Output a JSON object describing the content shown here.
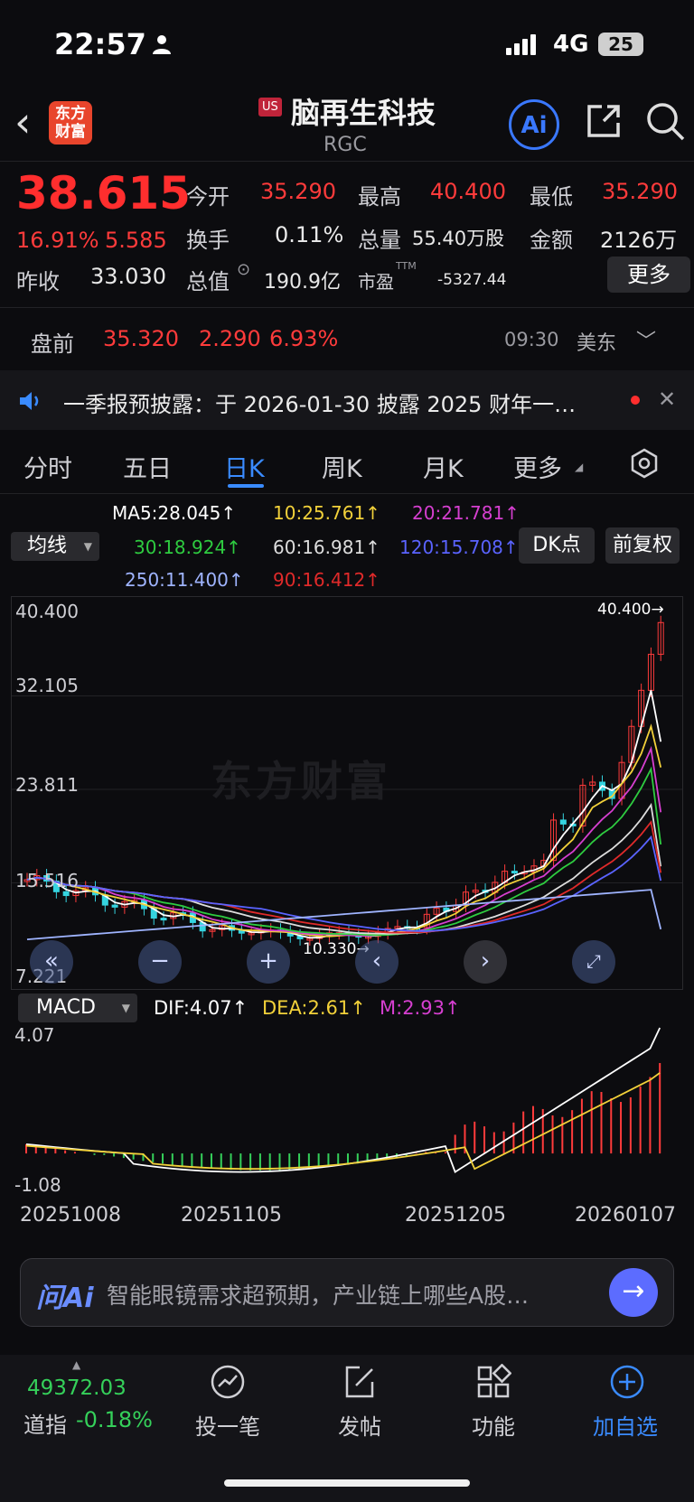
{
  "status_bar": {
    "time": "22:57",
    "network": "4G",
    "battery": "25"
  },
  "header": {
    "logo_line1": "东方",
    "logo_line2": "财富",
    "market_badge": "US",
    "stock_name": "脑再生科技",
    "ticker": "RGC",
    "ai_label": "Ai"
  },
  "quote": {
    "price": "38.615",
    "change_pct": "16.91%",
    "change_amt": "5.585",
    "open_label": "今开",
    "open": "35.290",
    "high_label": "最高",
    "high": "40.400",
    "low_label": "最低",
    "low": "35.290",
    "turnover_label": "换手",
    "turnover": "0.11%",
    "volume_label": "总量",
    "volume": "55.40万股",
    "amount_label": "金额",
    "amount": "2126万",
    "prev_close_label": "昨收",
    "prev_close": "33.030",
    "mcap_label": "总值",
    "mcap": "190.9亿",
    "pe_label": "市盈",
    "pe_sup": "TTM",
    "pe": "-5327.44",
    "more_label": "更多"
  },
  "premarket": {
    "label": "盘前",
    "price": "35.320",
    "change": "2.290",
    "pct": "6.93%",
    "time": "09:30",
    "zone": "美东"
  },
  "notice": {
    "text": "一季报预披露：于 2026-01-30 披露 2025 财年一…"
  },
  "tabs": {
    "t1": "分时",
    "t2": "五日",
    "t3": "日K",
    "t4": "周K",
    "t5": "月K",
    "t6": "更多"
  },
  "ma": {
    "selector": "均线",
    "ma5": "MA5:28.045↑",
    "ma10": "10:25.761↑",
    "ma20": "20:21.781↑",
    "ma30": "30:18.924↑",
    "ma60": "60:16.981↑",
    "ma120": "120:15.708↑",
    "ma250": "250:11.400↑",
    "ma90": "90:16.412↑",
    "dk_label": "DK点",
    "fq_label": "前复权",
    "colors": {
      "ma5": "#ffffff",
      "ma10": "#f2d13a",
      "ma20": "#d63fd0",
      "ma30": "#2ecc40",
      "ma60": "#dddddd",
      "ma120": "#5a63ff",
      "ma250": "#9fb4ff",
      "ma90": "#e02a2a"
    }
  },
  "kline": {
    "y_top": "40.400",
    "y_2": "32.105",
    "y_3": "23.811",
    "y_4": "15.516",
    "y_bottom": "7.221",
    "max_marker": "40.400→",
    "min_marker": "10.330→",
    "watermark": "东方财富"
  },
  "macd": {
    "selector": "MACD",
    "dif": "DIF:4.07↑",
    "dea": "DEA:2.61↑",
    "m": "M:2.93↑",
    "y_top": "4.07",
    "y_bottom": "-1.08"
  },
  "dates": {
    "d1": "20251008",
    "d2": "20251105",
    "d3": "20251205",
    "d4": "20260107"
  },
  "ai_bar": {
    "logo": "问Ai",
    "prompt": "智能眼镜需求超预期，产业链上哪些A股…"
  },
  "bottom_nav": {
    "index_value": "49372.03",
    "index_name": "道指",
    "index_change": "-0.18%",
    "item1": "投一笔",
    "item2": "发帖",
    "item3": "功能",
    "item4": "加自选"
  },
  "chart_data": {
    "type": "candlestick",
    "title": "",
    "y_range": [
      7.221,
      40.4
    ],
    "x_ticks": [
      "20251008",
      "20251105",
      "20251205",
      "20260107"
    ],
    "last_close": 38.615,
    "period_high": 40.4,
    "period_low": 10.33,
    "moving_averages": {
      "MA5": 28.045,
      "MA10": 25.761,
      "MA20": 21.781,
      "MA30": 18.924,
      "MA60": 16.981,
      "MA90": 16.412,
      "MA120": 15.708,
      "MA250": 11.4
    },
    "macd": {
      "DIF": 4.07,
      "DEA": 2.61,
      "M": 2.93,
      "y_range": [
        -1.08,
        4.07
      ]
    }
  }
}
